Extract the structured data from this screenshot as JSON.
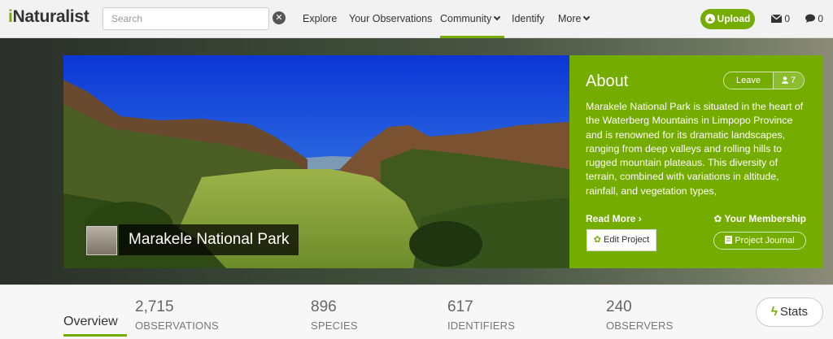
{
  "header": {
    "logo": {
      "prefix": "i",
      "rest": "Naturalist"
    },
    "search": {
      "placeholder": "Search",
      "clear_icon": "close-circle-icon"
    },
    "nav": {
      "explore": "Explore",
      "your_observations": "Your Observations",
      "community": "Community",
      "identify": "Identify",
      "more": "More"
    },
    "upload_label": "Upload",
    "messages_count": "0",
    "comments_count": "0",
    "accent_color": "#74ac00"
  },
  "project": {
    "title": "Marakele National Park",
    "about": {
      "heading": "About",
      "leave_label": "Leave",
      "members_count": "7",
      "description": "Marakele National Park is situated in the heart of the Waterberg Mountains in Limpopo Province and is renowned for its dramatic landscapes, ranging from deep valleys and rolling hills to rugged mountain plateaus. This diversity of terrain, combined with variations in altitude, rainfall, and vegetation types,",
      "read_more": "Read More",
      "your_membership": "Your Membership",
      "edit_project": "Edit Project",
      "project_journal": "Project Journal"
    }
  },
  "stats": {
    "overview_tab": "Overview",
    "items": [
      {
        "value": "2,715",
        "label": "OBSERVATIONS"
      },
      {
        "value": "896",
        "label": "SPECIES"
      },
      {
        "value": "617",
        "label": "IDENTIFIERS"
      },
      {
        "value": "240",
        "label": "OBSERVERS"
      }
    ],
    "stats_button": "Stats"
  }
}
